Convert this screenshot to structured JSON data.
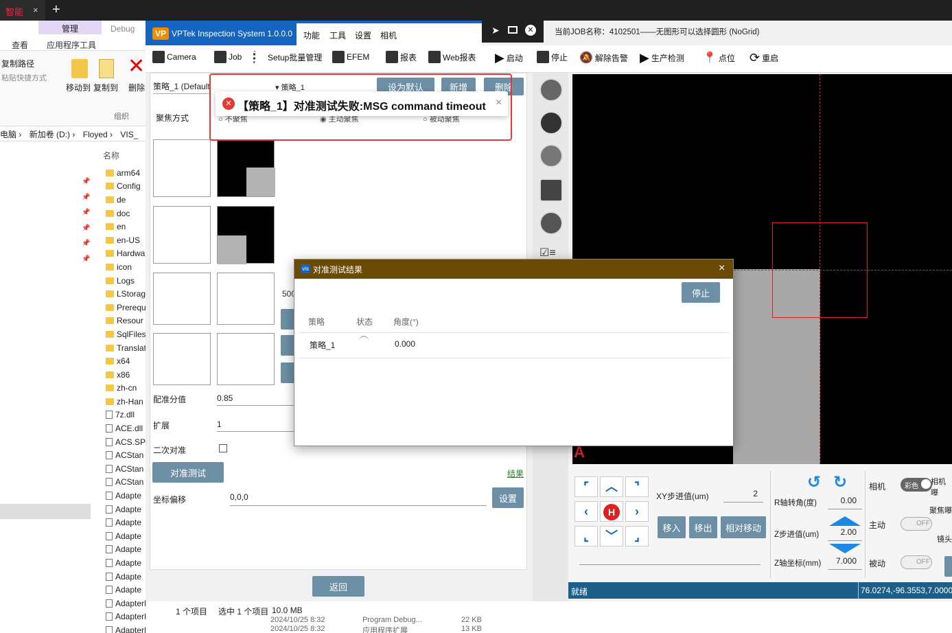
{
  "browser": {
    "tab_label": "智能",
    "tab_close": "×",
    "new_tab": "+"
  },
  "explorer": {
    "ribbon": {
      "manage_tab": "管理",
      "debug_tab": "Debug",
      "view_tab": "查看",
      "app_tools_tab": "应用程序工具",
      "copy_path": "复制路径",
      "paste_shortcut": "粘贴快捷方式",
      "move_to": "移动到",
      "copy_to": "复制到",
      "delete": "删除",
      "group_organize": "组织"
    },
    "address": [
      "电脑",
      "新加卷 (D:)",
      "Floyed",
      "VIS_"
    ],
    "list_header": "名称",
    "items": [
      {
        "name": "arm64",
        "type": "folder"
      },
      {
        "name": "Config",
        "type": "folder"
      },
      {
        "name": "de",
        "type": "folder"
      },
      {
        "name": "doc",
        "type": "folder"
      },
      {
        "name": "en",
        "type": "folder"
      },
      {
        "name": "en-US",
        "type": "folder"
      },
      {
        "name": "Hardwa",
        "type": "folder"
      },
      {
        "name": "icon",
        "type": "folder"
      },
      {
        "name": "Logs",
        "type": "folder"
      },
      {
        "name": "LStorag",
        "type": "folder"
      },
      {
        "name": "Prerequ",
        "type": "folder"
      },
      {
        "name": "Resour",
        "type": "folder"
      },
      {
        "name": "SqlFiles",
        "type": "folder"
      },
      {
        "name": "Translat",
        "type": "folder"
      },
      {
        "name": "x64",
        "type": "folder"
      },
      {
        "name": "x86",
        "type": "folder"
      },
      {
        "name": "zh-cn",
        "type": "folder"
      },
      {
        "name": "zh-Han",
        "type": "folder"
      },
      {
        "name": "7z.dll",
        "type": "file"
      },
      {
        "name": "ACE.dll",
        "type": "file"
      },
      {
        "name": "ACS.SPi",
        "type": "file"
      },
      {
        "name": "ACStan",
        "type": "file"
      },
      {
        "name": "ACStan",
        "type": "file"
      },
      {
        "name": "ACStan",
        "type": "file"
      },
      {
        "name": "Adapte",
        "type": "file"
      },
      {
        "name": "Adapte",
        "type": "file"
      },
      {
        "name": "Adapte",
        "type": "file"
      },
      {
        "name": "Adapte",
        "type": "file"
      },
      {
        "name": "Adapte",
        "type": "file"
      },
      {
        "name": "Adapte",
        "type": "file"
      },
      {
        "name": "Adapte",
        "type": "file"
      },
      {
        "name": "Adapte",
        "type": "file"
      },
      {
        "name": "AdapterMap.",
        "type": "file"
      },
      {
        "name": "AdapterMap.subEFSI.pdb",
        "type": "file"
      },
      {
        "name": "AdapterMap.ThreeD.dll",
        "type": "file"
      }
    ],
    "status": {
      "count": "1 个项目",
      "selected": "选中 1 个项目",
      "size": "10.0 MB"
    },
    "bottom_row": {
      "date1": "2024/10/25 8:32",
      "type1": "Program Debug...",
      "size1": "22 KB",
      "date2": "2024/10/25 8:32",
      "type2": "应用程序扩展",
      "size2": "13 KB"
    }
  },
  "app": {
    "logo": "VP",
    "title": "VPTek Inspection System 1.0.0.0",
    "menu": [
      "功能",
      "工具",
      "设置",
      "相机"
    ],
    "job_name": "当前JOB名称：4102501——无图形可以选择圆形 (NoGrid)",
    "toolbar": [
      "Camera",
      "Job",
      "Setup批量管理",
      "EFEM",
      "报表",
      "Web报表",
      "启动",
      "停止",
      "解除告警",
      "生产检测",
      "点位",
      "重启"
    ],
    "left": {
      "strategy_select": "策略_1 (Default",
      "strategy_select2": "策略_1",
      "set_default": "设为默认",
      "add": "新增",
      "delete": "删除",
      "focus_mode": "聚焦方式",
      "focus_opts": [
        "不聚焦",
        "主动聚焦",
        "被动聚焦"
      ],
      "partial_value": "500",
      "match_score_label": "配准分值",
      "match_score": "0.85",
      "expand_label": "扩展",
      "expand": "1",
      "secondary_label": "二次对准",
      "align_test": "对准测试",
      "result_link": "结果",
      "offset_label": "坐标偏移",
      "offset": "0,0,0",
      "set": "设置",
      "back": "返回"
    },
    "toast": {
      "message": "【策略_1】对准测试失败:MSG command timeout",
      "close": "×"
    },
    "dialog": {
      "title": "对准测试结果",
      "badge": "vis",
      "close": "×",
      "stop": "停止",
      "columns": [
        "策略",
        "状态",
        "角度(°)"
      ],
      "rows": [
        {
          "strategy": "策略_1",
          "angle": "0.000"
        }
      ]
    },
    "camera": {
      "marker": "A"
    },
    "controls": {
      "home": "H",
      "xy_step_label": "XY步进值(um)",
      "xy_step": "2",
      "move_in": "移入",
      "move_out": "移出",
      "relative_move": "相对移动",
      "r_angle_label": "R轴转角(度)",
      "r_angle": "0.00",
      "z_step_label": "Z步进值(um)",
      "z_step": "2.00",
      "z_coord_label": "Z轴坐标(mm)",
      "z_coord": "7.000",
      "camera_label": "相机",
      "color_toggle": "彩色",
      "active_label": "主动",
      "passive_label": "被动",
      "off": "OFF",
      "camera_clip": "相机曝",
      "focus_clip": "聚焦曝",
      "lens_clip": "镜头"
    },
    "status": {
      "text": "就绪",
      "coords": "76.0274,-96.3553,7.0000"
    }
  },
  "colors": {
    "titlebar": "#1565c0",
    "dialog_title": "#6b4a06",
    "error": "#e53935",
    "button": "#6d8fa5",
    "crosshair": "#e02020"
  }
}
